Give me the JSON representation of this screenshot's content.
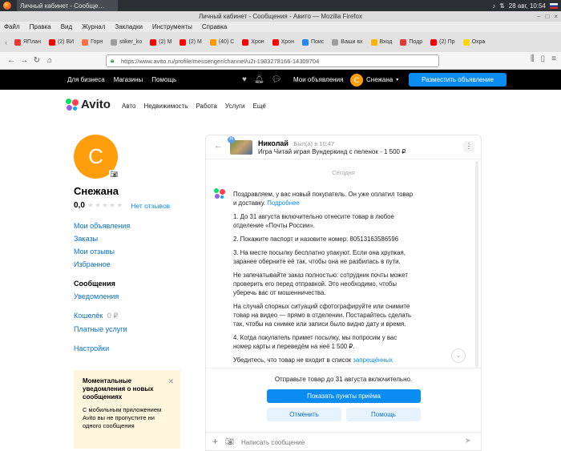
{
  "taskbar": {
    "app_title": "Личный кабинет - Сообще…",
    "datetime": "28 авг, 10:54"
  },
  "window": {
    "title": "Личный кабинет - Сообщения - Авито — Mozilla Firefox"
  },
  "menubar": {
    "items": [
      "Файл",
      "Правка",
      "Вид",
      "Журнал",
      "Закладки",
      "Инструменты",
      "Справка"
    ]
  },
  "tabs": [
    {
      "label": "ЯПлан",
      "color": "#e53935"
    },
    {
      "label": "(2) ВИ",
      "color": "#ff0000"
    },
    {
      "label": "Горн",
      "color": "#ff7043"
    },
    {
      "label": "stiker_ko",
      "color": "#9e9e9e"
    },
    {
      "label": "(2) М",
      "color": "#ff0000"
    },
    {
      "label": "(2) М",
      "color": "#ff0000"
    },
    {
      "label": "(40) С",
      "color": "#ff9800"
    },
    {
      "label": "Хрон",
      "color": "#ff0000"
    },
    {
      "label": "Хрон",
      "color": "#ff0000"
    },
    {
      "label": "Поис",
      "color": "#2787f5"
    },
    {
      "label": "Ваши вх",
      "color": "#9e9e9e"
    },
    {
      "label": "Вход",
      "color": "#ffb300"
    },
    {
      "label": "Подр",
      "color": "#e53935"
    },
    {
      "label": "(2) Пр",
      "color": "#ff0000"
    },
    {
      "label": "Охра",
      "color": "#ffd600"
    }
  ],
  "navbar": {
    "url": "https://www.avito.ru/profile/messenger/channel/u2i-1983278166-14309704"
  },
  "avito_header": {
    "links": [
      "Для бизнеса",
      "Магазины",
      "Помощь"
    ],
    "my_ads": "Мои объявления",
    "user_initial": "С",
    "user_name": "Снежана",
    "post_button": "Разместить объявление"
  },
  "logo": {
    "text": "Avito"
  },
  "categories": [
    "Авто",
    "Недвижимость",
    "Работа",
    "Услуги",
    "Ещё"
  ],
  "profile": {
    "initial": "С",
    "name": "Снежана",
    "rating": "0,0",
    "reviews": "Нет отзывов"
  },
  "sidebar_menu": {
    "group1": [
      "Мои объявления",
      "Заказы",
      "Мои отзывы",
      "Избранное"
    ],
    "messages_heading": "Сообщения",
    "notifications": "Уведомления",
    "wallet": "Кошелёк",
    "wallet_amount": "0 ₽",
    "paid_services": "Платные услуги",
    "settings": "Настройки"
  },
  "notice": {
    "title": "Моментальные уведомления о новых сообщениях",
    "body": "С мобильным приложением Avito вы не пропустите ни одного сообщения"
  },
  "chat": {
    "contact_name": "Николай",
    "last_seen": "Был(а) в 10:47",
    "item": "Игра Читай играя Вундеркинд с пеленок · 1 500 ₽",
    "badge": "Н",
    "date_divider": "Сегодня",
    "message": {
      "p1": "Поздравляем, у вас новый покупатель. Он уже оплатил товар и доставку.",
      "p1_link": "Подробнее",
      "p2": "1. До 31 августа включительно отнесите товар в любое отделение «Почты России».",
      "p3": "2. Покажите паспорт и назовите номер: 80513163586596",
      "p4": "3. На месте посылку бесплатно упакуют. Если она хрупкая, заранее оберните её так, чтобы она не разбилась в пути.",
      "p5": "Не запечатывайте заказ полностью: сотрудник почты может проверить его перед отправкой. Это необходимо, чтобы уберечь вас от мошенничества.",
      "p6": "На случай спорных ситуаций сфотографируйте или снимите товар на видео — прямо в отделении. Постарайтесь сделать так, чтобы на снимке или записи было видно дату и время.",
      "p7": "4. Когда покупатель примет посылку, мы попросим у вас номер карты и переведём на неё 1 500 ₽.",
      "p8": "Убедитесь, что товар не входит в список",
      "p8_link": "запрещённых"
    },
    "deadline": "Отправьте товар до 31 августа включительно.",
    "show_points_button": "Показать пункты приёма",
    "cancel_button": "Отменить",
    "help_button": "Помощь",
    "input_placeholder": "Написать сообщение"
  },
  "colors": {
    "accent": "#0a8cf0",
    "avatar": "#ff9e0d",
    "notice_bg": "#fff6dd"
  }
}
